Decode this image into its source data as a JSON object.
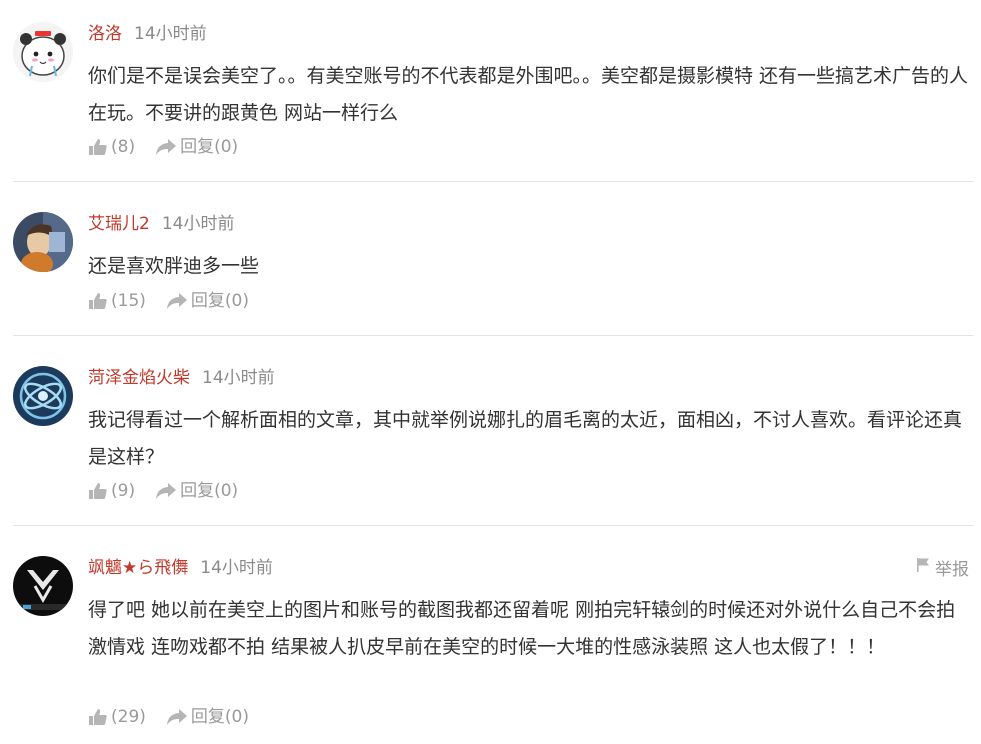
{
  "comments": [
    {
      "username": "洛洛",
      "time": "14小时前",
      "text": "你们是不是误会美空了。。有美空账号的不代表都是外围吧。。美空都是摄影模特 还有一些搞艺术广告的人在玩。不要讲的跟黄色 网站一样行么",
      "like_count": "(8)",
      "reply_label": "回复(0)"
    },
    {
      "username": "艾瑞儿2",
      "time": "14小时前",
      "text": "还是喜欢胖迪多一些",
      "like_count": "(15)",
      "reply_label": "回复(0)"
    },
    {
      "username": "菏泽金焰火柴",
      "time": "14小时前",
      "text": "我记得看过一个解析面相的文章，其中就举例说娜扎的眉毛离的太近，面相凶，不讨人喜欢。看评论还真是这样？",
      "like_count": "(9)",
      "reply_label": "回复(0)"
    },
    {
      "username": "飒魑★ら飛儛",
      "time": "14小时前",
      "text": "得了吧 她以前在美空上的图片和账号的截图我都还留着呢 刚拍完轩辕剑的时候还对外说什么自己不会拍激情戏 连吻戏都不拍 结果被人扒皮早前在美空的时候一大堆的性感泳装照 这人也太假了！！！",
      "like_count": "(29)",
      "reply_label": "回复(0)",
      "report_label": "举报"
    }
  ],
  "colors": {
    "username": "#c0392b",
    "muted": "#9a9a9a",
    "text": "#333333",
    "divider": "#e3e3e3"
  },
  "icons": {
    "like": "thumbs-up-icon",
    "reply": "share-arrow-icon",
    "report": "flag-icon"
  }
}
